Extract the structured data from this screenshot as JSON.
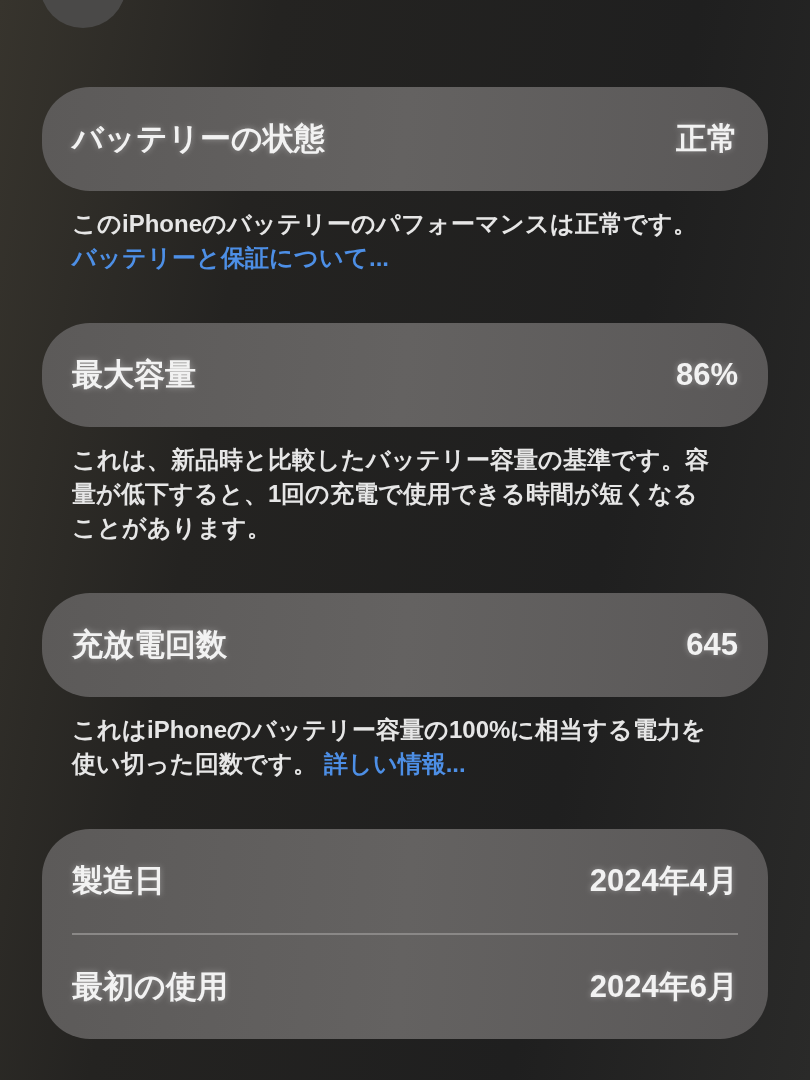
{
  "sections": [
    {
      "rows": [
        {
          "label": "バッテリーの状態",
          "value": "正常"
        }
      ],
      "footer": {
        "text": "このiPhoneのバッテリーのパフォーマンスは正常です。",
        "link": "バッテリーと保証について..."
      }
    },
    {
      "rows": [
        {
          "label": "最大容量",
          "value": "86%"
        }
      ],
      "footer": {
        "text": "これは、新品時と比較したバッテリー容量の基準です。容量が低下すると、1回の充電で使用できる時間が短くなることがあります。"
      }
    },
    {
      "rows": [
        {
          "label": "充放電回数",
          "value": "645"
        }
      ],
      "footer": {
        "text": "これはiPhoneのバッテリー容量の100%に相当する電力を使い切った回数です。",
        "link": "詳しい情報..."
      }
    },
    {
      "rows": [
        {
          "label": "製造日",
          "value": "2024年4月"
        },
        {
          "label": "最初の使用",
          "value": "2024年6月"
        }
      ]
    }
  ]
}
